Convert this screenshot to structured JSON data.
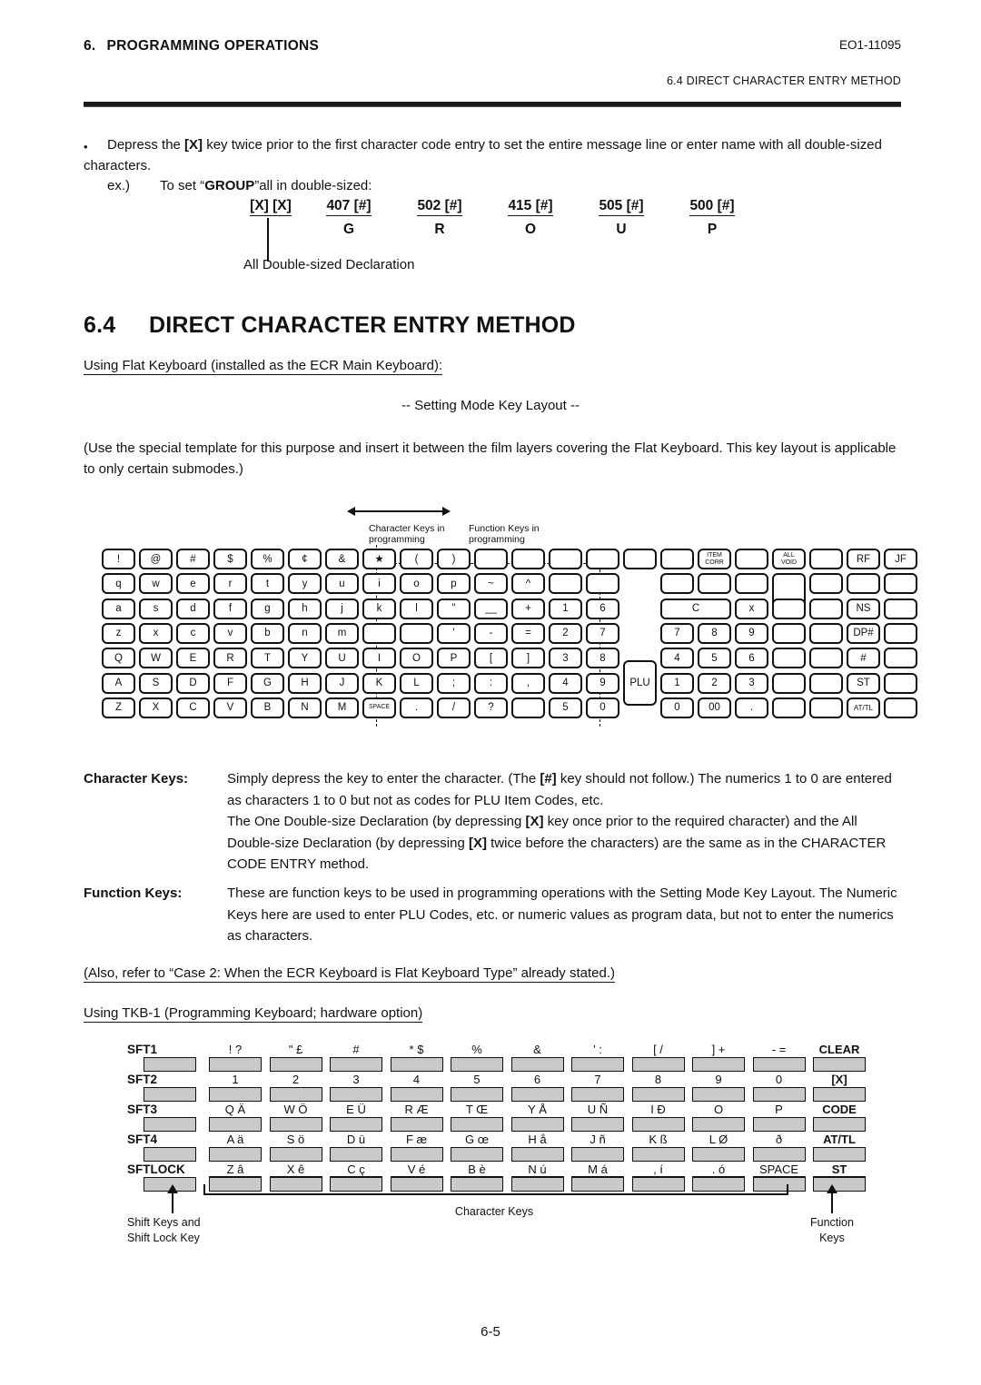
{
  "header": {
    "chapter_num": "6.",
    "chapter_title": "PROGRAMMING OPERATIONS",
    "doc_code": "EO1-11095",
    "section_ref": "6.4  DIRECT CHARACTER ENTRY METHOD"
  },
  "bullet": {
    "marker": "•",
    "text_before_x": "Depress the ",
    "x_key": "[X]",
    "text_after_x": " key twice prior to the first character code entry to set the entire message line or enter name with all double-sized characters.",
    "ex_label": "ex.)",
    "ex_text_a": "To set “",
    "ex_group": "GROUP",
    "ex_text_b": "”all in double-sized:",
    "codes": [
      "[X]  [X]",
      "407 [#]",
      "502 [#]",
      "415 [#]",
      "505 [#]",
      "500 [#]"
    ],
    "chars": [
      "",
      "G",
      "R",
      "O",
      "U",
      "P"
    ],
    "declaration": "All Double-sized Declaration"
  },
  "section": {
    "number": "6.4",
    "title": "DIRECT CHARACTER ENTRY METHOD",
    "intro_underlined": "Using Flat Keyboard (installed as the ECR Main Keyboard):",
    "centered_caption": "-- Setting Mode Key Layout --",
    "note_paragraph": "(Use the special template for this purpose and insert it between the film layers covering the Flat Keyboard. This key layout is applicable to only certain submodes.)"
  },
  "flat_keyboard": {
    "annotation_left": "Character Keys in\nprogramming",
    "annotation_right": "Function Keys in\nprogramming",
    "rows": [
      [
        "!",
        "@",
        "#",
        "$",
        "%",
        "¢",
        "&",
        "★",
        "(",
        ")",
        "",
        "",
        "",
        "",
        "",
        "",
        "ITEM\nCORR",
        "",
        "ALL\nVOID",
        "",
        "RF",
        "JF"
      ],
      [
        "q",
        "w",
        "e",
        "r",
        "t",
        "y",
        "u",
        "i",
        "o",
        "p",
        "~",
        "^",
        "",
        "",
        "",
        "",
        "",
        "",
        "",
        "",
        "",
        ""
      ],
      [
        "a",
        "s",
        "d",
        "f",
        "g",
        "h",
        "j",
        "k",
        "l",
        "\"",
        "__",
        "+",
        "1",
        "6",
        "",
        "C",
        "",
        "x",
        "",
        "",
        "NS",
        ""
      ],
      [
        "z",
        "x",
        "c",
        "v",
        "b",
        "n",
        "m",
        "",
        "",
        "'",
        "-",
        "=",
        "2",
        "7",
        "",
        "7",
        "8",
        "9",
        "",
        "",
        "DP#",
        ""
      ],
      [
        "Q",
        "W",
        "E",
        "R",
        "T",
        "Y",
        "U",
        "I",
        "O",
        "P",
        "[",
        "]",
        "3",
        "8",
        "",
        "4",
        "5",
        "6",
        "",
        "",
        "#",
        ""
      ],
      [
        "A",
        "S",
        "D",
        "F",
        "G",
        "H",
        "J",
        "K",
        "L",
        ";",
        ":",
        ",",
        "4",
        "9",
        "PLU",
        "1",
        "2",
        "3",
        "",
        "",
        "ST",
        ""
      ],
      [
        "Z",
        "X",
        "C",
        "V",
        "B",
        "N",
        "M",
        "SPACE",
        ".",
        "/",
        "?",
        "",
        "5",
        "0",
        "",
        "0",
        "00",
        ".",
        "",
        "",
        "AT/TL",
        ""
      ]
    ]
  },
  "character_keys": {
    "label": "Character Keys:",
    "line1_a": "Simply depress the key to enter the character. (The ",
    "line1_hash": "[#]",
    "line1_b": " key should not follow.) The numerics 1 to 0 are entered as characters 1 to 0 but not as codes for PLU Item Codes, etc.",
    "line2_a": "The One Double-size Declaration (by depressing ",
    "line2_x": "[X]",
    "line2_b": " key once prior to the required character) and the All Double-size Declaration (by depressing ",
    "line2_x2": "[X]",
    "line2_c": " twice before the characters) are the same as in the CHARACTER CODE ENTRY method."
  },
  "function_keys": {
    "label": "Function Keys:",
    "text": "These are function keys to be used in programming operations with the Setting Mode Key Layout. The Numeric Keys here are used to enter PLU Codes, etc. or numeric values as program data, but not to enter the numerics as characters."
  },
  "also_refer": "(Also, refer to “Case 2:  When the ECR Keyboard is Flat Keyboard Type” already stated.)",
  "tkb_intro": "Using TKB-1 (Programming Keyboard;  hardware option)",
  "tkb_keyboard": {
    "rows": [
      {
        "shift": "SFT1",
        "keys": [
          "! ?",
          "\" £",
          "#",
          "* $",
          "%",
          "&",
          "' :",
          "[ /",
          "] +",
          "- =",
          "CLEAR"
        ]
      },
      {
        "shift": "SFT2",
        "keys": [
          "1",
          "2",
          "3",
          "4",
          "5",
          "6",
          "7",
          "8",
          "9",
          "0",
          "[X]"
        ]
      },
      {
        "shift": "SFT3",
        "keys": [
          "Q Ä",
          "W Ö",
          "E Ü",
          "R Æ",
          "T Œ",
          "Y Å",
          "U Ñ",
          "I Ð",
          "O",
          "P",
          "CODE"
        ]
      },
      {
        "shift": "SFT4",
        "keys": [
          "A ä",
          "S ö",
          "D ü",
          "F æ",
          "G œ",
          "H å",
          "J ñ",
          "K ß",
          "L Ø",
          "ð",
          "AT/TL"
        ]
      },
      {
        "shift": "SFTLOCK",
        "keys": [
          "Z â",
          "X ê",
          "C ç",
          "V é",
          "B è",
          "N ú",
          "M á",
          ", í",
          ". ó",
          "SPACE",
          "ST"
        ]
      }
    ],
    "ann_shift": "Shift Keys and\nShift Lock Key",
    "ann_char": "Character Keys",
    "ann_func": "Function\nKeys"
  },
  "footer": {
    "page": "6-5"
  }
}
